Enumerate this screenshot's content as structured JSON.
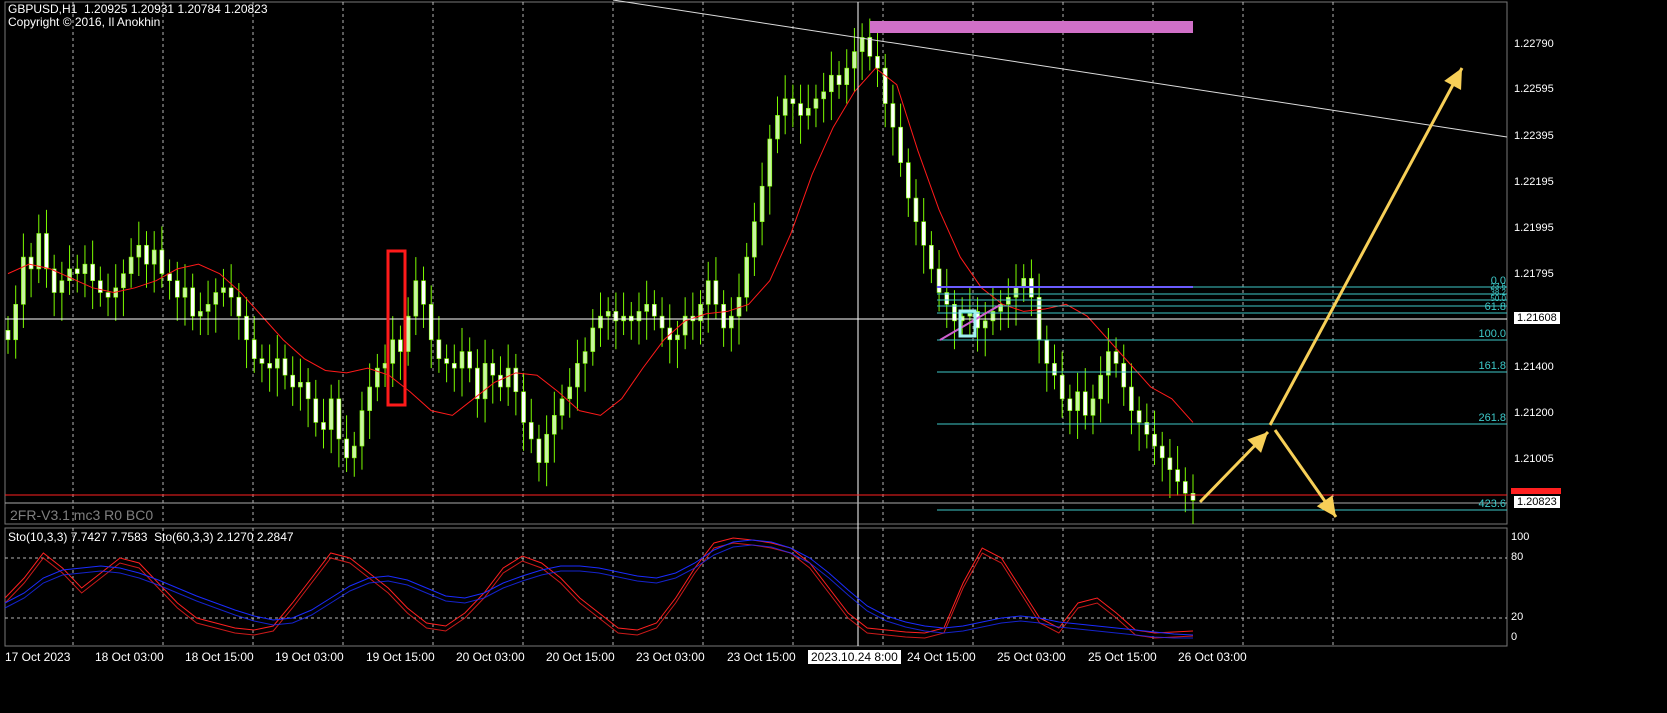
{
  "header": {
    "symbol_line": "GBPUSD,H1  1.20925 1.20931 1.20784 1.20823",
    "copyright": "Copyright © 2016, Il Anokhin"
  },
  "indicator_overlay": "2FR-V3.1 mc3 R0 BC0",
  "stoch_header": "Sto(10,3,3) 7.7427 7.7583  Sto(60,3,3) 2.1270 2.2847",
  "colors": {
    "background": "#000000",
    "bull_candle": "#c8f5a0",
    "bear_candle": "#ffffff",
    "wick": "#7cfc00",
    "ma": "#ff1a1a",
    "grid": "#ffffff",
    "fib": "#3ec9c9",
    "arrow": "#f7cf57",
    "highlight_bar": "#d070c8",
    "current_price_tag": "#ffffff",
    "red_tag": "#ff2020",
    "stoch_fast": "#ff2020",
    "stoch_slow": "#1a2cff"
  },
  "price_axis": {
    "labels": [
      "1.22790",
      "1.22595",
      "1.22395",
      "1.22195",
      "1.21995",
      "1.21795",
      "1.21608",
      "1.21400",
      "1.21200",
      "1.21005",
      "1.20823"
    ]
  },
  "stoch_axis": {
    "labels": [
      "100",
      "80",
      "20",
      "0"
    ]
  },
  "time_axis": {
    "labels": [
      "17 Oct 2023",
      "18 Oct 03:00",
      "18 Oct 15:00",
      "19 Oct 03:00",
      "19 Oct 15:00",
      "20 Oct 03:00",
      "20 Oct 15:00",
      "23 Oct 03:00",
      "23 Oct 15:00",
      "2023.10.24 8:00",
      "24 Oct 15:00",
      "25 Oct 03:00",
      "25 Oct 15:00",
      "26 Oct 03:00"
    ]
  },
  "fib_levels": [
    "0.0",
    "23.6",
    "38.2",
    "50.0",
    "61.8",
    "100.0",
    "161.8",
    "261.8",
    "423.6"
  ],
  "chart_data": [
    {
      "type": "candlestick",
      "symbol": "GBPUSD",
      "timeframe": "H1",
      "last": {
        "open": 1.20925,
        "high": 1.20931,
        "low": 1.20784,
        "close": 1.20823
      },
      "ylim": [
        1.2072,
        1.2293
      ],
      "x_labels": [
        "17 Oct 2023",
        "18 Oct 03:00",
        "18 Oct 15:00",
        "19 Oct 03:00",
        "19 Oct 15:00",
        "20 Oct 03:00",
        "20 Oct 15:00",
        "23 Oct 03:00",
        "23 Oct 15:00",
        "2023.10.24 8:00",
        "24 Oct 15:00",
        "25 Oct 03:00",
        "25 Oct 15:00",
        "26 Oct 03:00"
      ],
      "closes": [
        1.215,
        1.2165,
        1.2185,
        1.218,
        1.2195,
        1.218,
        1.217,
        1.2175,
        1.218,
        1.2178,
        1.2182,
        1.2175,
        1.217,
        1.2168,
        1.2172,
        1.2178,
        1.2185,
        1.219,
        1.2182,
        1.2188,
        1.2178,
        1.2175,
        1.2168,
        1.2172,
        1.216,
        1.2162,
        1.2165,
        1.217,
        1.2172,
        1.2168,
        1.216,
        1.215,
        1.2142,
        1.214,
        1.2138,
        1.2142,
        1.2135,
        1.213,
        1.2132,
        1.2125,
        1.2115,
        1.2112,
        1.2125,
        1.2108,
        1.21,
        1.2105,
        1.212,
        1.213,
        1.2138,
        1.214,
        1.215,
        1.2145,
        1.216,
        1.2175,
        1.2165,
        1.215,
        1.2142,
        1.214,
        1.2138,
        1.2145,
        1.2138,
        1.2125,
        1.214,
        1.2135,
        1.213,
        1.2138,
        1.2128,
        1.2115,
        1.2108,
        1.2098,
        1.211,
        1.2118,
        1.2125,
        1.213,
        1.214,
        1.2145,
        1.2155,
        1.216,
        1.2162,
        1.2158,
        1.216,
        1.2158,
        1.2162,
        1.2165,
        1.216,
        1.2155,
        1.215,
        1.2152,
        1.216,
        1.2158,
        1.2165,
        1.2175,
        1.2165,
        1.2155,
        1.216,
        1.2168,
        1.2185,
        1.22,
        1.2215,
        1.2235,
        1.2245,
        1.2252,
        1.225,
        1.2245,
        1.2248,
        1.2252,
        1.2255,
        1.2262,
        1.2258,
        1.2265,
        1.2272,
        1.2278,
        1.227,
        1.2265,
        1.225,
        1.224,
        1.2225,
        1.221,
        1.22,
        1.219,
        1.218,
        1.217,
        1.2165,
        1.2158,
        1.216,
        1.2162,
        1.2155,
        1.2158,
        1.2162,
        1.2165,
        1.2168,
        1.2172,
        1.2176,
        1.2168,
        1.215,
        1.214,
        1.2135,
        1.2125,
        1.212,
        1.2128,
        1.2118,
        1.2125,
        1.2135,
        1.2145,
        1.214,
        1.213,
        1.212,
        1.2115,
        1.211,
        1.2105,
        1.21,
        1.2095,
        1.209,
        1.2085,
        1.2082
      ],
      "series": [
        {
          "values": [
            1.2178,
            1.2182,
            1.218,
            1.2176,
            1.2172,
            1.217,
            1.2172,
            1.2175,
            1.218,
            1.2182,
            1.2178,
            1.217,
            1.216,
            1.215,
            1.2142,
            1.2137,
            1.2136,
            1.2138,
            1.2135,
            1.2128,
            1.212,
            1.2118,
            1.2125,
            1.2132,
            1.2136,
            1.2135,
            1.2128,
            1.212,
            1.2118,
            1.2125,
            1.2138,
            1.215,
            1.2158,
            1.2161,
            1.2162,
            1.2165,
            1.2175,
            1.2195,
            1.222,
            1.224,
            1.2255,
            1.2265,
            1.2258,
            1.223,
            1.2205,
            1.2185,
            1.2172,
            1.2165,
            1.2162,
            1.2163,
            1.2165,
            1.216,
            1.215,
            1.214,
            1.213,
            1.2125,
            1.2115
          ]
        }
      ]
    },
    {
      "type": "line",
      "title": "Sto(10,3,3) 7.7427 7.7583  Sto(60,3,3) 2.1270 2.2847",
      "ylim": [
        0,
        100
      ],
      "series": [
        {
          "values": [
            40,
            60,
            85,
            70,
            50,
            65,
            80,
            75,
            55,
            35,
            20,
            15,
            10,
            8,
            12,
            35,
            60,
            85,
            80,
            65,
            50,
            30,
            15,
            12,
            25,
            45,
            70,
            82,
            75,
            60,
            40,
            25,
            10,
            8,
            15,
            40,
            70,
            95,
            100,
            98,
            95,
            90,
            75,
            50,
            25,
            10,
            8,
            6,
            5,
            10,
            55,
            90,
            80,
            50,
            20,
            10,
            35,
            40,
            25,
            8,
            5,
            6,
            7
          ]
        },
        {
          "values": [
            35,
            45,
            60,
            68,
            70,
            72,
            70,
            65,
            58,
            50,
            42,
            35,
            28,
            22,
            18,
            20,
            28,
            40,
            52,
            60,
            62,
            58,
            50,
            42,
            40,
            45,
            55,
            62,
            68,
            72,
            72,
            70,
            66,
            62,
            60,
            65,
            75,
            88,
            96,
            98,
            96,
            90,
            80,
            65,
            48,
            32,
            22,
            16,
            12,
            10,
            12,
            16,
            20,
            22,
            20,
            16,
            14,
            12,
            10,
            8,
            6,
            4,
            3
          ]
        }
      ]
    }
  ]
}
